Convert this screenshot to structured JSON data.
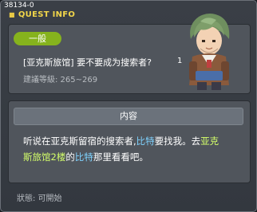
{
  "window": {
    "id_text": "38134-0",
    "title": "QUEST INFO"
  },
  "quest": {
    "category_badge": "一般",
    "name": "[亚克斯旅馆] 要不要成为搜索者?",
    "count": "1",
    "level_text": "建議等級: 265~269"
  },
  "content": {
    "header": "内容",
    "segments": [
      {
        "text": "听说在亚克斯留宿的搜索者,"
      },
      {
        "text": "比特"
      },
      {
        "text": "要找我。去"
      },
      {
        "text": "亚克"
      },
      {
        "text": "斯旅馆2楼"
      },
      {
        "text": "的"
      },
      {
        "text": "比特"
      },
      {
        "text": "那里看看吧。"
      }
    ]
  },
  "status": {
    "text": "狀態: 可開始"
  },
  "colors": {
    "title": "#f2d64a",
    "badge": "#86b31d",
    "npc_highlight": "#7fd3ff",
    "location_highlight": "#d4ff6a"
  }
}
